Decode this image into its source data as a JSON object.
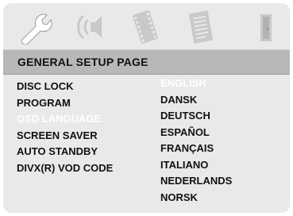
{
  "icons": [
    {
      "name": "wrench-icon"
    },
    {
      "name": "speaker-icon"
    },
    {
      "name": "film-icon"
    },
    {
      "name": "document-icon"
    },
    {
      "name": "door-icon"
    }
  ],
  "header": {
    "title": "GENERAL SETUP PAGE"
  },
  "menu": {
    "items": [
      "DISC LOCK",
      "PROGRAM",
      "OSD LANGUAGE",
      "SCREEN SAVER",
      "AUTO STANDBY",
      "DIVX(R) VOD CODE"
    ],
    "highlighted": "OSD LANGUAGE"
  },
  "options": {
    "items": [
      "ENGLISH",
      "DANSK",
      "DEUTSCH",
      "ESPAÑOL",
      "FRANÇAIS",
      "ITALIANO",
      "NEDERLANDS",
      "NORSK"
    ],
    "selected": "ENGLISH"
  },
  "colors": {
    "background": "#e9e9e9",
    "title_bar": "#b8b8b8",
    "highlight_text": "#ffffff",
    "icon_active": "#ffffff",
    "icon_inactive": "#c9c9c9"
  }
}
